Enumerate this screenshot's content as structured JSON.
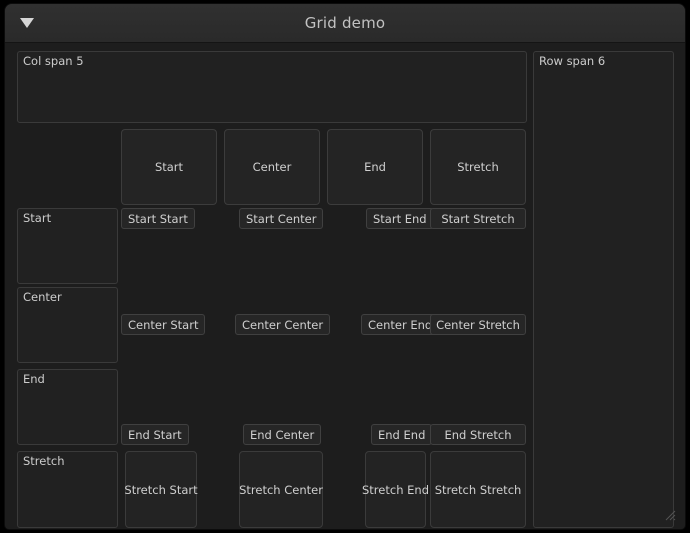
{
  "window": {
    "title": "Grid demo",
    "collapse_icon": "triangle-down-icon"
  },
  "grid": {
    "col_span_box_label": "Col span 5",
    "row_span_box_label": "Row span 6",
    "column_headers": [
      "Start",
      "Center",
      "End",
      "Stretch"
    ],
    "row_headers": [
      "Start",
      "Center",
      "End",
      "Stretch"
    ],
    "cells": [
      [
        "Start Start",
        "Start Center",
        "Start End",
        "Start Stretch"
      ],
      [
        "Center Start",
        "Center Center",
        "Center End",
        "Center Stretch"
      ],
      [
        "End Start",
        "End Center",
        "End End",
        "End Stretch"
      ],
      [
        "Stretch Start",
        "Stretch Center",
        "Stretch End",
        "Stretch Stretch"
      ]
    ]
  },
  "colors": {
    "window_bg": "#1e1e1e",
    "titlebar_bg": "#2e2e2e",
    "frame_border": "#3a3a3a",
    "text": "#cfcfcf"
  }
}
